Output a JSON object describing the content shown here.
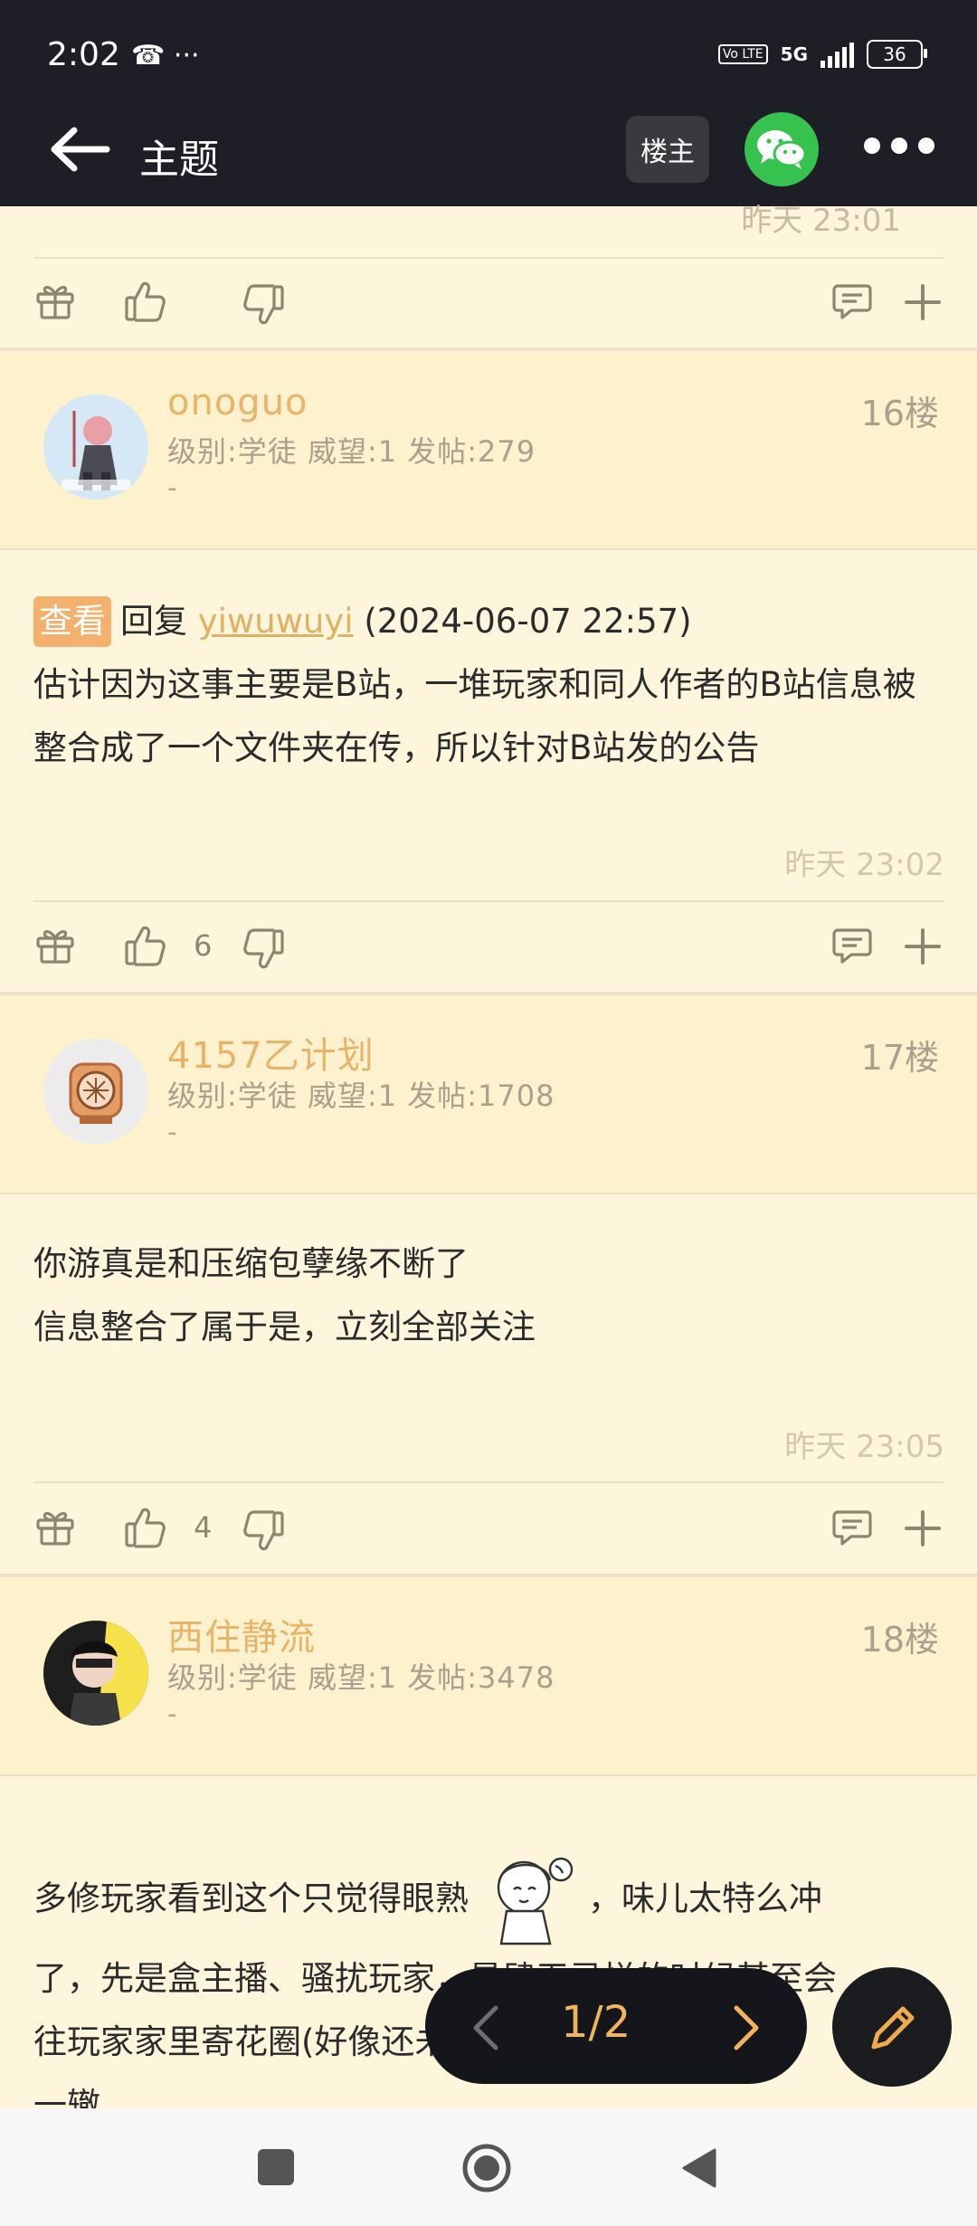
{
  "status": {
    "time": "2:02",
    "icons": "☎ ···",
    "volte": "Vo LTE",
    "net": "5G",
    "battery": "36"
  },
  "appbar": {
    "title": "主题",
    "op_label": "楼主"
  },
  "prev_post": {
    "time": "昨天 23:01"
  },
  "posts": [
    {
      "username": "onoguo",
      "meta": "级别:学徒 威望:1 发帖:279",
      "dash": "-",
      "floor": "16楼",
      "quote": {
        "badge": "查看",
        "reply_word": "回复",
        "reply_user": "yiwuwuyi",
        "reply_date": "(2024-06-07 22:57)"
      },
      "text": "估计因为这事主要是B站，一堆玩家和同人作者的B站信息被整合成了一个文件夹在传，所以针对B站发的公告",
      "time": "昨天 23:02",
      "likes": "6"
    },
    {
      "username": "4157乙计划",
      "meta": "级别:学徒 威望:1 发帖:1708",
      "dash": "-",
      "floor": "17楼",
      "line1": "你游真是和压缩包孽缘不断了",
      "line2": "信息整合了属于是，立刻全部关注",
      "time": "昨天 23:05",
      "likes": "4"
    },
    {
      "username": "西住静流",
      "meta": "级别:学徒 威望:1 发帖:3478",
      "dash": "-",
      "floor": "18楼",
      "line1a": "多修玩家看到这个只觉得眼熟",
      "line1b": "，味儿太特么冲",
      "line2": "了，先是盒主播、骚扰玩家，最肆无忌惮的时候甚至会",
      "line3": "往玩家家里寄花圈(好像还未发展到这一步)，做法",
      "line4": "一辙"
    }
  ],
  "pager": {
    "label": "1/2"
  },
  "colors": {
    "bg": "#fdf5dc",
    "topbar": "#1d1e26",
    "accent": "#f0b35e",
    "wechat": "#37c14e"
  }
}
